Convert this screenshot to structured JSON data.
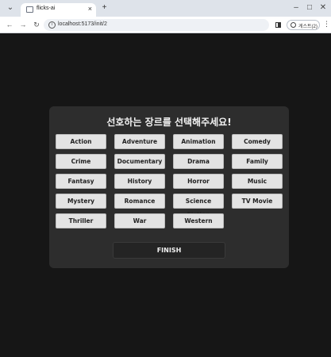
{
  "browser": {
    "tab_title": "flicks-ai",
    "tab_close": "×",
    "new_tab": "+",
    "url": "localhost:5173/init/2",
    "profile_label": "게스트(2)",
    "controls": {
      "minimize": "–",
      "maximize": "□",
      "close": "✕"
    },
    "nav": {
      "back": "←",
      "forward": "→",
      "reload": "↻",
      "tab_search": "⌄",
      "menu": "⋮"
    }
  },
  "page": {
    "heading": "선호하는 장르를 선택해주세요!",
    "genres": [
      "Action",
      "Adventure",
      "Animation",
      "Comedy",
      "Crime",
      "Documentary",
      "Drama",
      "Family",
      "Fantasy",
      "History",
      "Horror",
      "Music",
      "Mystery",
      "Romance",
      "Science Fiction",
      "TV Movie",
      "Thriller",
      "War",
      "Western"
    ],
    "finish_label": "FINISH"
  }
}
